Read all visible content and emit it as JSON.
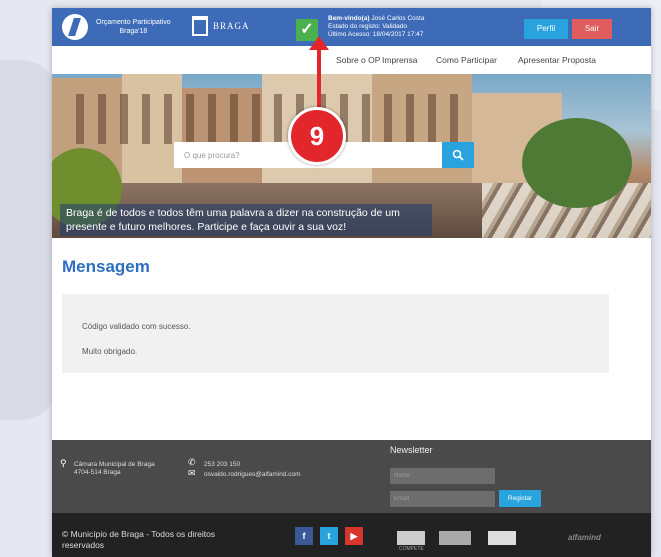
{
  "header": {
    "op_logo_line1": "Orçamento Participativo",
    "op_logo_line2": "Braga'18",
    "braga_logo": "BRAGA",
    "status": {
      "welcome_label": "Bem-vindo(a)",
      "user_name": "José Carlos Costa",
      "registration_status": "Estado do registo: Validado",
      "last_access": "Último Acesso: 18/04/2017 17:47"
    },
    "perfil_label": "Perfil",
    "sair_label": "Sair"
  },
  "nav": {
    "items": [
      {
        "label": "Sobre o OP"
      },
      {
        "label": "Imprensa"
      },
      {
        "label": "Como Participar"
      },
      {
        "label": "Apresentar Proposta"
      }
    ]
  },
  "hero": {
    "search_placeholder": "O que procura?",
    "tagline_line1": "Braga é de todos e todos têm uma palavra a dizer na construção de um",
    "tagline_line2": "presente e futuro melhores. Participe e faça ouvir a sua voz!"
  },
  "annotation": {
    "number": "9"
  },
  "main": {
    "title": "Mensagem",
    "message_line1": "Código validado com sucesso.",
    "message_line2": "Muito obrigado."
  },
  "footer": {
    "address_line1": "Câmara Municipal de Braga",
    "address_line2": "4704-514 Braga",
    "phone": "253 203 150",
    "email": "osvaldo.rodrigues@alfamind.com",
    "newsletter_title": "Newsletter",
    "name_placeholder": "Nome",
    "email_placeholder": "Email",
    "registar_label": "Registar",
    "copyright_line1": "© Município de Braga - Todos os direitos",
    "copyright_line2": "reservados",
    "social": {
      "facebook": "f",
      "twitter": "t",
      "youtube": "▶"
    },
    "partner_compete": "COMPETE",
    "brand": "alfamind"
  },
  "colors": {
    "primary_blue": "#3d6bb8",
    "accent_blue": "#29a3dd",
    "sair_red": "#e05b5b",
    "annotation_red": "#e3262b",
    "validated_green": "#4caf50"
  }
}
